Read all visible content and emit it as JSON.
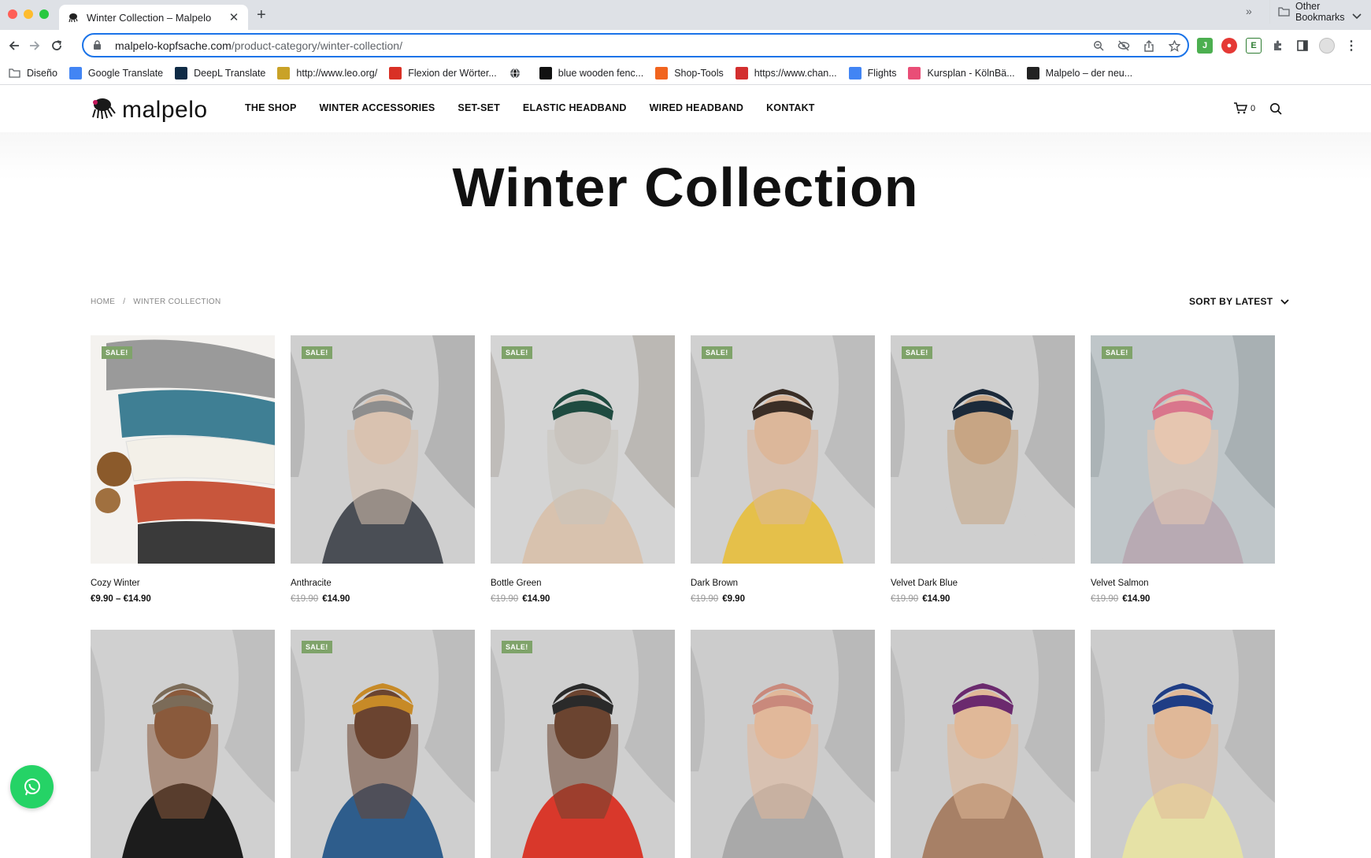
{
  "browser": {
    "tab_title": "Winter Collection – Malpelo",
    "url_host": "malpelo-kopfsache.com",
    "url_path": "/product-category/winter-collection/",
    "bookmarks": [
      {
        "label": "Diseño",
        "icon": "folder-icon",
        "color": "#5f6368"
      },
      {
        "label": "Google Translate",
        "icon": "google-translate-icon",
        "color": "#4285f4"
      },
      {
        "label": "DeepL Translate",
        "icon": "deepl-icon",
        "color": "#0f2b46"
      },
      {
        "label": "http://www.leo.org/",
        "icon": "leo-icon",
        "color": "#c9a227"
      },
      {
        "label": "Flexion der Wörter...",
        "icon": "flexion-icon",
        "color": "#d93025"
      },
      {
        "label": "",
        "icon": "globe-icon",
        "color": "#5f6368"
      },
      {
        "label": "blue wooden fenc...",
        "icon": "unsplash-icon",
        "color": "#111111"
      },
      {
        "label": "Shop-Tools",
        "icon": "etsy-icon",
        "color": "#f1641e"
      },
      {
        "label": "https://www.chan...",
        "icon": "chan-icon",
        "color": "#d32f2f"
      },
      {
        "label": "Flights",
        "icon": "flights-icon",
        "color": "#4285f4"
      },
      {
        "label": "Kursplan - KölnBä...",
        "icon": "kursplan-icon",
        "color": "#e94e77"
      },
      {
        "label": "Malpelo – der neu...",
        "icon": "malpelo-icon",
        "color": "#222222"
      }
    ],
    "bookmarks_more": "»",
    "other_bookmarks": "Other Bookmarks"
  },
  "site": {
    "logo_text": "malpelo",
    "nav": [
      "THE SHOP",
      "WINTER ACCESSORIES",
      "SET-SET",
      "ELASTIC HEADBAND",
      "WIRED HEADBAND",
      "KONTAKT"
    ],
    "cart_count": "0"
  },
  "page": {
    "title": "Winter Collection",
    "breadcrumb": [
      "HOME",
      "/",
      "WINTER COLLECTION"
    ],
    "sort_label": "SORT BY LATEST",
    "sale_badge": "SALE!"
  },
  "products": [
    {
      "name": "Cozy Winter",
      "old_price": "",
      "price": "€9.90 – €14.90",
      "sale": true
    },
    {
      "name": "Anthracite",
      "old_price": "€19.90",
      "price": "€14.90",
      "sale": true
    },
    {
      "name": "Bottle Green",
      "old_price": "€19.90",
      "price": "€14.90",
      "sale": true
    },
    {
      "name": "Dark Brown",
      "old_price": "€19.90",
      "price": "€9.90",
      "sale": true
    },
    {
      "name": "Velvet Dark Blue",
      "old_price": "€19.90",
      "price": "€14.90",
      "sale": true
    },
    {
      "name": "Velvet Salmon",
      "old_price": "€19.90",
      "price": "€14.90",
      "sale": true
    },
    {
      "name": "",
      "old_price": "",
      "price": "",
      "sale": false
    },
    {
      "name": "",
      "old_price": "",
      "price": "",
      "sale": true
    },
    {
      "name": "",
      "old_price": "",
      "price": "",
      "sale": true
    },
    {
      "name": "",
      "old_price": "",
      "price": "",
      "sale": false
    },
    {
      "name": "",
      "old_price": "",
      "price": "",
      "sale": false
    },
    {
      "name": "",
      "old_price": "",
      "price": "",
      "sale": false
    }
  ],
  "colors": {
    "sale_badge": "#7fa36a",
    "omnibox_focus": "#1a73e8",
    "whatsapp": "#25d366"
  }
}
